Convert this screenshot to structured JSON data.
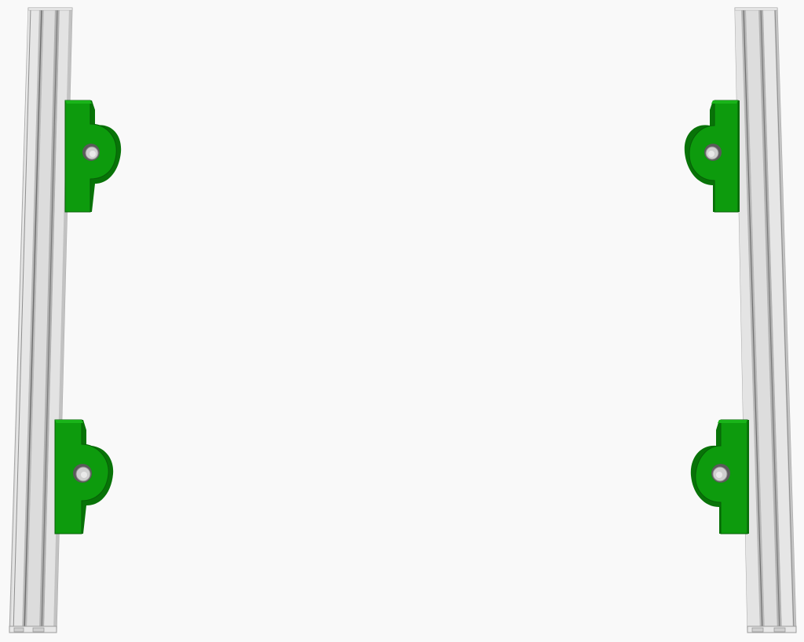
{
  "scene": {
    "background_color": "#f9f9f9",
    "extrusion_color": "#d5d5d5",
    "extrusion_highlight": "#ececec",
    "extrusion_shadow": "#9c9c9c",
    "bracket_color": "#0d9b0d",
    "bracket_dark": "#087308",
    "bracket_light": "#19b419",
    "hole_color": "#cfcfcf",
    "objects": [
      {
        "name": "left-aluminum-extrusion",
        "type": "rail"
      },
      {
        "name": "right-aluminum-extrusion",
        "type": "rail"
      },
      {
        "name": "bracket-top-left",
        "type": "mount"
      },
      {
        "name": "bracket-bottom-left",
        "type": "mount"
      },
      {
        "name": "bracket-top-right",
        "type": "mount"
      },
      {
        "name": "bracket-bottom-right",
        "type": "mount"
      }
    ]
  }
}
